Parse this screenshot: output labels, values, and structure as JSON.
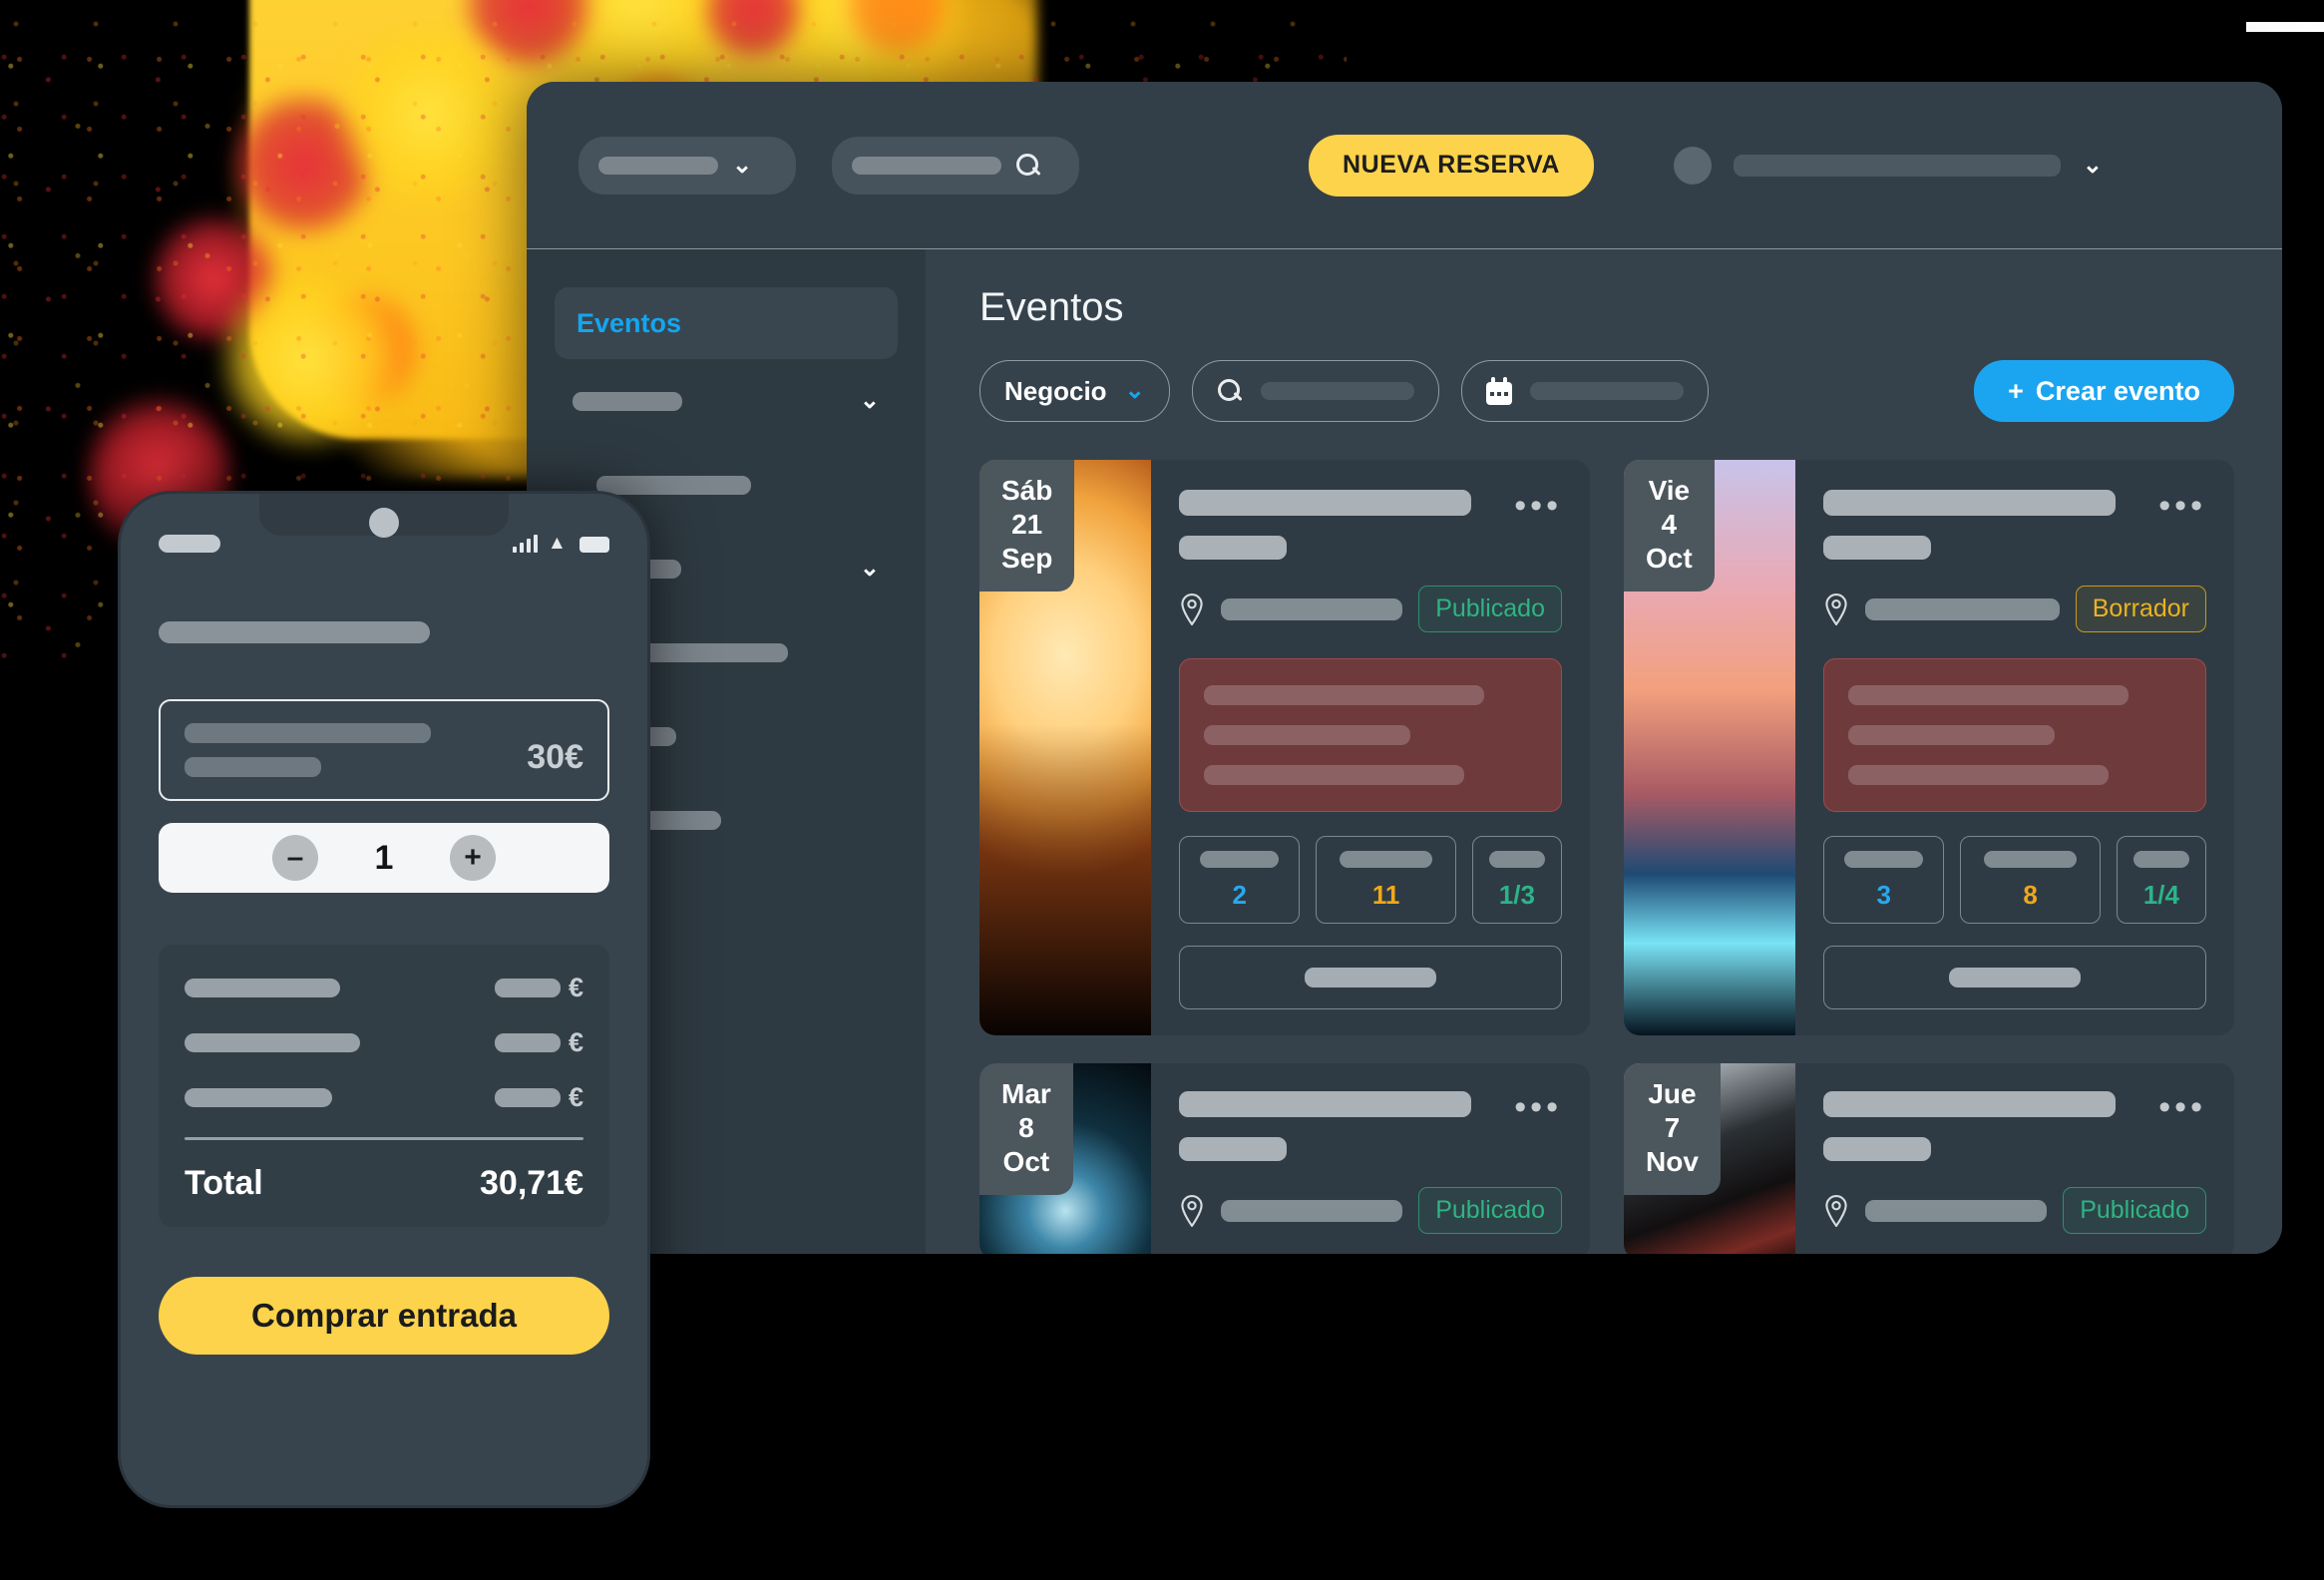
{
  "app": {
    "topbar": {
      "workspace_select_placeholder": "",
      "search_placeholder": "",
      "primary_button": "NUEVA RESERVA",
      "search_icon": "search-icon",
      "chevron_icon": "chevron-down-icon",
      "avatar_icon": "avatar"
    },
    "sidebar": {
      "active_item": "Eventos",
      "items": [
        {
          "label": "",
          "has_chevron": true
        },
        {
          "label": "",
          "has_chevron": false
        },
        {
          "label": "",
          "has_chevron": true
        },
        {
          "label": "",
          "has_chevron": false
        },
        {
          "label": "",
          "has_chevron": false
        },
        {
          "label": "",
          "has_chevron": false
        }
      ]
    },
    "main": {
      "page_title": "Eventos",
      "filters": {
        "business_label": "Negocio",
        "business_chevron": "chevron-down-icon",
        "search_placeholder": "",
        "date_placeholder": "",
        "search_icon": "search-icon",
        "calendar_icon": "calendar-icon"
      },
      "create_button": {
        "plus": "+",
        "label": "Crear evento"
      },
      "events": [
        {
          "day": "Sáb",
          "date": "21",
          "month": "Sep",
          "status": "Publicado",
          "status_type": "published",
          "thumb": "concert-crowd",
          "stats": [
            {
              "value": "2",
              "color": "blue"
            },
            {
              "value": "11",
              "color": "amber"
            },
            {
              "value": "1/3",
              "color": "teal"
            }
          ],
          "compact": false
        },
        {
          "day": "Vie",
          "date": "4",
          "month": "Oct",
          "status": "Borrador",
          "status_type": "draft",
          "thumb": "dj-turntable",
          "stats": [
            {
              "value": "3",
              "color": "blue"
            },
            {
              "value": "8",
              "color": "amber"
            },
            {
              "value": "1/4",
              "color": "teal"
            }
          ],
          "compact": false
        },
        {
          "day": "Mar",
          "date": "8",
          "month": "Oct",
          "status": "Publicado",
          "status_type": "published",
          "thumb": "fireworks",
          "stats": [],
          "compact": true
        },
        {
          "day": "Jue",
          "date": "7",
          "month": "Nov",
          "status": "Publicado",
          "status_type": "published",
          "thumb": "stage-lights",
          "stats": [],
          "compact": true
        }
      ],
      "overflow_menu_glyph": "•••"
    }
  },
  "phone": {
    "status_bar": {
      "signal_icon": "cellular-signal-icon",
      "wifi_icon": "wifi-icon",
      "battery_icon": "battery-icon"
    },
    "ticket": {
      "price": "30€"
    },
    "stepper": {
      "minus": "–",
      "quantity": "1",
      "plus": "+"
    },
    "summary": {
      "rows": [
        {
          "currency": "€"
        },
        {
          "currency": "€"
        },
        {
          "currency": "€"
        }
      ],
      "total_label": "Total",
      "total_value": "30,71€"
    },
    "buy_button": "Comprar entrada"
  },
  "colors": {
    "accent_yellow": "#fcd34b",
    "accent_blue": "#1ba5f0",
    "published_green": "#2fb483",
    "draft_amber": "#e9b322",
    "stat_blue": "#28a9ef",
    "stat_amber": "#f0a81a",
    "stat_teal": "#2bb48a",
    "window_bg": "#36424b",
    "card_bg": "#2f3b44",
    "sidebar_bg": "#2e3a42",
    "desc_box": "#6e3a3c",
    "page_bg": "#000000"
  }
}
